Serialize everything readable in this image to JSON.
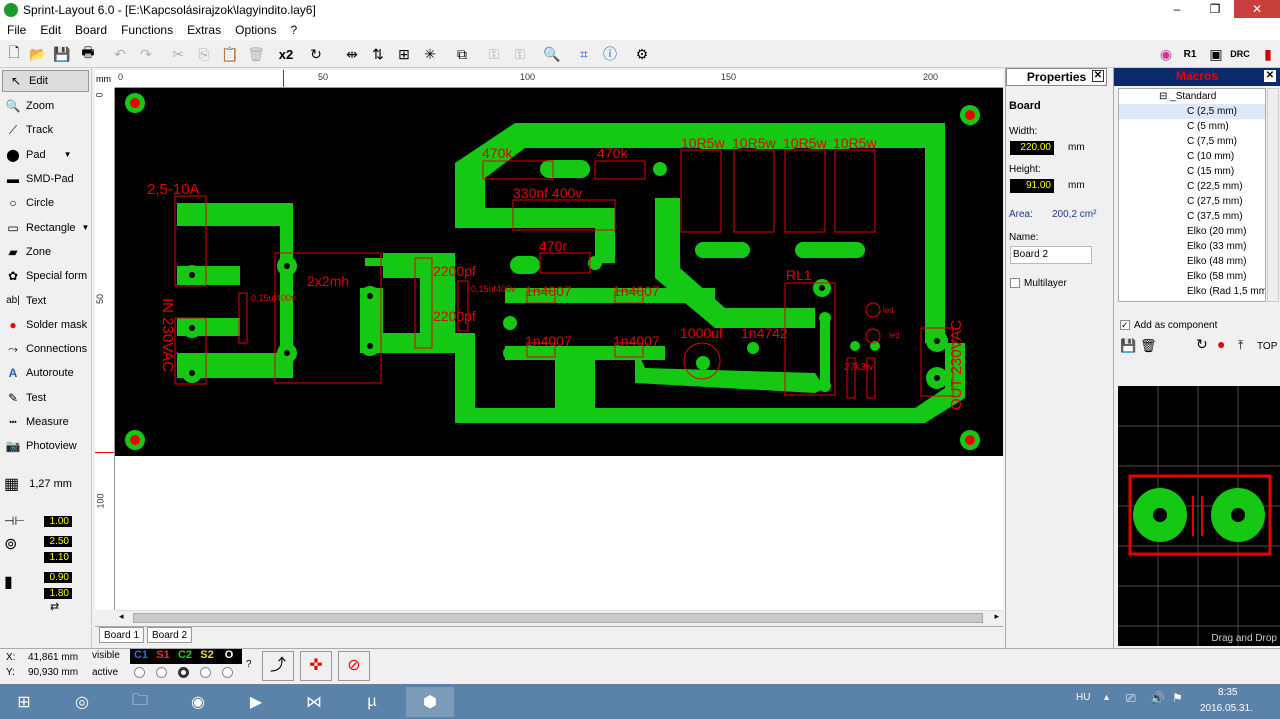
{
  "window": {
    "title": "Sprint-Layout 6.0 - [E:\\Kapcsolásirajzok\\lagyindito.lay6]",
    "min": "‒",
    "max": "❐",
    "close": "✕"
  },
  "menu": [
    "File",
    "Edit",
    "Board",
    "Functions",
    "Extras",
    "Options",
    "?"
  ],
  "toolbar": {
    "x2": "x2"
  },
  "tools": [
    {
      "label": "Edit",
      "icon": "cursor-icon"
    },
    {
      "label": "Zoom",
      "icon": "magnifier-icon"
    },
    {
      "label": "Track",
      "icon": "track-icon"
    },
    {
      "label": "Pad",
      "icon": "pad-icon"
    },
    {
      "label": "SMD-Pad",
      "icon": "smd-pad-icon"
    },
    {
      "label": "Circle",
      "icon": "circle-icon"
    },
    {
      "label": "Rectangle",
      "icon": "rectangle-icon"
    },
    {
      "label": "Zone",
      "icon": "zone-icon"
    },
    {
      "label": "Special form",
      "icon": "special-form-icon"
    },
    {
      "label": "Text",
      "icon": "text-icon"
    },
    {
      "label": "Solder mask",
      "icon": "solder-mask-icon"
    },
    {
      "label": "Connections",
      "icon": "connections-icon"
    },
    {
      "label": "Autoroute",
      "icon": "autoroute-icon"
    },
    {
      "label": "Test",
      "icon": "test-icon"
    },
    {
      "label": "Measure",
      "icon": "measure-icon"
    },
    {
      "label": "Photoview",
      "icon": "photoview-icon"
    }
  ],
  "grid": {
    "label": "1,27 mm"
  },
  "sizes": {
    "track": "1.00",
    "pad_outer": "2.50",
    "pad_inner": "1.10",
    "smd_w": "0.90",
    "smd_h": "1.80"
  },
  "ruler": {
    "unit": "mm",
    "h": [
      "0",
      "50",
      "100",
      "150",
      "200"
    ],
    "v": [
      "0",
      "50",
      "100"
    ]
  },
  "board_texts": {
    "fuse": "2,5-10A",
    "in": "IN 230VAC",
    "out": "OUT 230VAC",
    "choke": "2x2mh",
    "cap1": "0,15uf400v",
    "cap2": "0,15uf400v",
    "c2200a": "2200pf",
    "c2200b": "2200pf",
    "r470a": "470k",
    "r470b": "470k",
    "c330": "330nf 400v",
    "r470r": "470r",
    "d1": "1n4007",
    "d2": "1n4007",
    "d3": "1n4007",
    "d4": "1n4007",
    "r10a": "10R5w",
    "r10b": "10R5w",
    "r10c": "10R5w",
    "r10d": "10R5w",
    "rl1": "RL1",
    "c1000": "1000uf",
    "z": "1n4742",
    "r27": "27k3w",
    "led1": "led",
    "led2": "led",
    "in_lbl": "IN",
    "out_lbl": "OUT"
  },
  "boardtabs": [
    "Board 1",
    "Board 2"
  ],
  "properties": {
    "header": "Properties",
    "section": "Board",
    "width_label": "Width:",
    "width": "220.00",
    "height_label": "Height:",
    "height": "91.00",
    "unit": "mm",
    "area_label": "Area:",
    "area": "200,2 cm²",
    "name_label": "Name:",
    "name": "Board 2",
    "multilayer": "Multilayer"
  },
  "macros": {
    "header": "Macros",
    "items": [
      "_Standard",
      "C (2,5 mm)",
      "C (5 mm)",
      "C (7,5 mm)",
      "C (10 mm)",
      "C (15 mm)",
      "C (22,5 mm)",
      "C (27,5 mm)",
      "C (37,5 mm)",
      "Elko (20 mm)",
      "Elko (33 mm)",
      "Elko (48 mm)",
      "Elko (58 mm)",
      "Elko (Rad 1,5 mm"
    ],
    "add_component": "Add as component",
    "top": "TOP",
    "drag_drop": "Drag and Drop"
  },
  "status": {
    "x_label": "X:",
    "x": "41,861 mm",
    "y_label": "Y:",
    "y": "90,930 mm",
    "visible": "visible",
    "active": "active",
    "layers": [
      "C1",
      "S1",
      "C2",
      "S2",
      "O"
    ],
    "help": "?"
  },
  "taskbar": {
    "lang": "HU",
    "time": "8:35",
    "date": "2016.05.31."
  },
  "colors": {
    "copper": "#14c814",
    "silk": "#e60000",
    "board": "#000000",
    "macros_head": "#0b2a6b"
  }
}
